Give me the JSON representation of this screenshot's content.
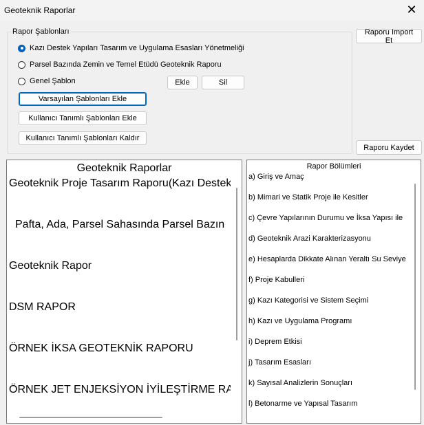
{
  "window": {
    "title": "Geoteknik Raporlar",
    "close_glyph": "✕"
  },
  "templates": {
    "legend": "Rapor Şablonları",
    "options": [
      {
        "label": "Kazı Destek Yapıları Tasarım ve Uygulama Esasları Yönetmeliği",
        "selected": true
      },
      {
        "label": "Parsel Bazında Zemin ve Temel Etüdü Geoteknik Raporu",
        "selected": false
      },
      {
        "label": "Genel Şablon",
        "selected": false
      }
    ],
    "add_label": "Ekle",
    "delete_label": "Sil",
    "add_defaults_label": "Varsayılan Şablonları Ekle",
    "add_user_label": "Kullanıcı Tanımlı Şablonları Ekle",
    "remove_user_label": "Kullanıcı Tanımlı Şablonları Kaldır"
  },
  "actions": {
    "import_label": "Raporu Import Et",
    "save_label": "Raporu Kaydet"
  },
  "reports": {
    "header": "Geoteknik Raporlar",
    "items": [
      "Geoteknik Proje Tasarım Raporu(Kazı Destek",
      "Pafta,  Ada,  Parsel Sahasında Parsel Bazın",
      "Geoteknik Rapor",
      "DSM RAPOR",
      "ÖRNEK İKSA GEOTEKNİK RAPORU",
      "ÖRNEK JET ENJEKSİYON İYİLEŞTİRME RA"
    ]
  },
  "sections": {
    "header": "Rapor Bölümleri",
    "items": [
      "a) Giriş ve Amaç",
      "b) Mimari ve Statik Proje ile Kesitler",
      "c) Çevre Yapılarının Durumu ve İksa Yapısı ile",
      "d) Geoteknik Arazi Karakterizasyonu",
      "e) Hesaplarda Dikkate Alınan Yeraltı Su Seviye",
      "f) Proje Kabulleri",
      "g) Kazı Kategorisi ve Sistem Seçimi",
      "h) Kazı ve Uygulama Programı",
      "i) Deprem Etkisi",
      "j) Tasarım Esasları",
      "k) Sayısal Analizlerin Sonuçları",
      "l) Betonarme ve Yapısal Tasarım"
    ]
  }
}
